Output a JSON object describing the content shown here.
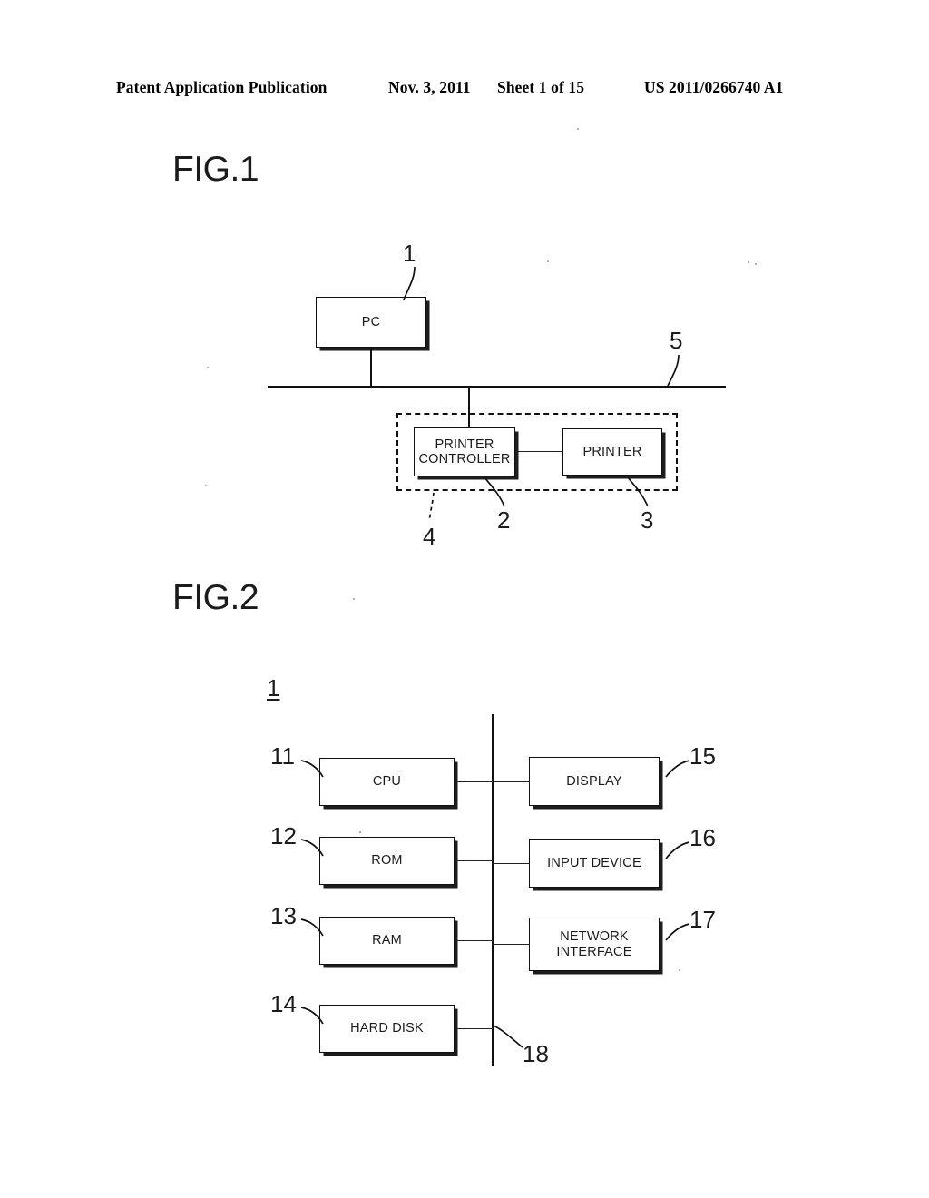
{
  "header": {
    "publication": "Patent Application Publication",
    "date": "Nov. 3, 2011",
    "sheet": "Sheet 1 of 15",
    "doc_number": "US 2011/0266740 A1"
  },
  "figures": [
    {
      "title": "FIG.1",
      "boxes": [
        {
          "id": "pc",
          "label": "PC",
          "ref": "1"
        },
        {
          "id": "printer-controller",
          "label": "PRINTER\nCONTROLLER",
          "ref": "2"
        },
        {
          "id": "printer",
          "label": "PRINTER",
          "ref": "3"
        }
      ],
      "group": {
        "id": "printing-system",
        "ref": "4"
      },
      "network": {
        "id": "network-bus",
        "ref": "5"
      }
    },
    {
      "title": "FIG.2",
      "system_ref": "1",
      "boxes": [
        {
          "id": "cpu",
          "label": "CPU",
          "ref": "11"
        },
        {
          "id": "rom",
          "label": "ROM",
          "ref": "12"
        },
        {
          "id": "ram",
          "label": "RAM",
          "ref": "13"
        },
        {
          "id": "hard-disk",
          "label": "HARD DISK",
          "ref": "14"
        },
        {
          "id": "display",
          "label": "DISPLAY",
          "ref": "15"
        },
        {
          "id": "input-device",
          "label": "INPUT DEVICE",
          "ref": "16"
        },
        {
          "id": "network-interface",
          "label": "NETWORK\nINTERFACE",
          "ref": "17"
        }
      ],
      "bus": {
        "id": "system-bus",
        "ref": "18"
      }
    }
  ],
  "colors": {
    "ink": "#111111",
    "paper": "#ffffff"
  }
}
